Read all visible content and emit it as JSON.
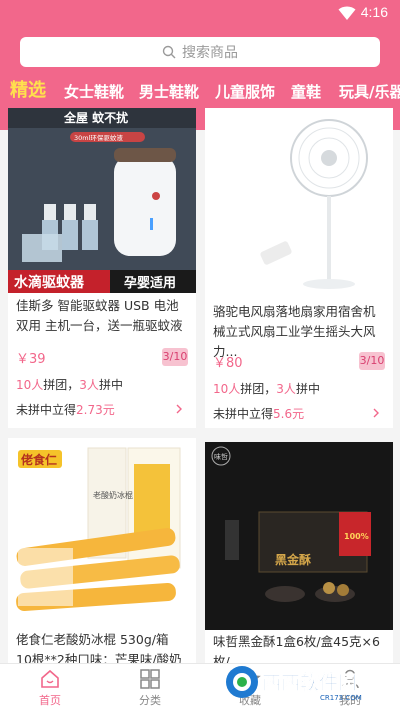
{
  "status": {
    "time": "4:16"
  },
  "search": {
    "placeholder": "搜索商品"
  },
  "tabs": [
    {
      "label": "精选",
      "active": true
    },
    {
      "label": "女士鞋靴",
      "active": false
    },
    {
      "label": "男士鞋靴",
      "active": false
    },
    {
      "label": "儿童服饰",
      "active": false
    },
    {
      "label": "童鞋",
      "active": false
    },
    {
      "label": "玩具/乐器",
      "active": false
    }
  ],
  "products": [
    {
      "image_text": {
        "top": "全屋 蚊不扰",
        "sub": "30ml环保驱蚊液",
        "banner": "水滴驱蚊器",
        "banner_right": "孕婴适用"
      },
      "title": "佳斯多 智能驱蚊器 USB 电池双用 主机一台，送一瓶驱蚊液",
      "price": "￥39",
      "progress": "3/10",
      "group_count": "10人",
      "group_label": "拼团，",
      "joined": "3人",
      "joined_label": "拼中",
      "refund_label": "未拼中立得",
      "refund_amount": "2.73元"
    },
    {
      "title": "骆驼电风扇落地扇家用宿舍机械立式风扇工业学生摇头大风力...",
      "price": "￥80",
      "progress": "3/10",
      "group_count": "10人",
      "group_label": "拼团，",
      "joined": "3人",
      "joined_label": "拼中",
      "refund_label": "未拼中立得",
      "refund_amount": "5.6元"
    },
    {
      "image_text": {
        "brand": "佬食仁",
        "box": "老酸奶冰棍"
      },
      "title": "佬食仁老酸奶冰棍 530g/箱 10根**2种口味：芒果味/酸奶味...",
      "price": "",
      "progress": ""
    },
    {
      "image_text": {
        "brand": "味哲",
        "product": "黑金酥",
        "badge": "100%"
      },
      "title": "味哲黑金酥1盒6枚/盒45克×6枚/",
      "price": "",
      "progress": ""
    }
  ],
  "bottom_nav": [
    {
      "label": "首页",
      "icon": "home-icon",
      "active": true
    },
    {
      "label": "分类",
      "icon": "grid-icon",
      "active": false
    },
    {
      "label": "收藏",
      "icon": "star-icon",
      "active": false
    },
    {
      "label": "我的",
      "icon": "user-icon",
      "active": false
    }
  ],
  "watermark": {
    "text": "西西软件园",
    "url": "CR173.COM"
  },
  "colors": {
    "header": "#f2678b",
    "accent": "#f2678b",
    "tab_active": "#ffe14d"
  }
}
